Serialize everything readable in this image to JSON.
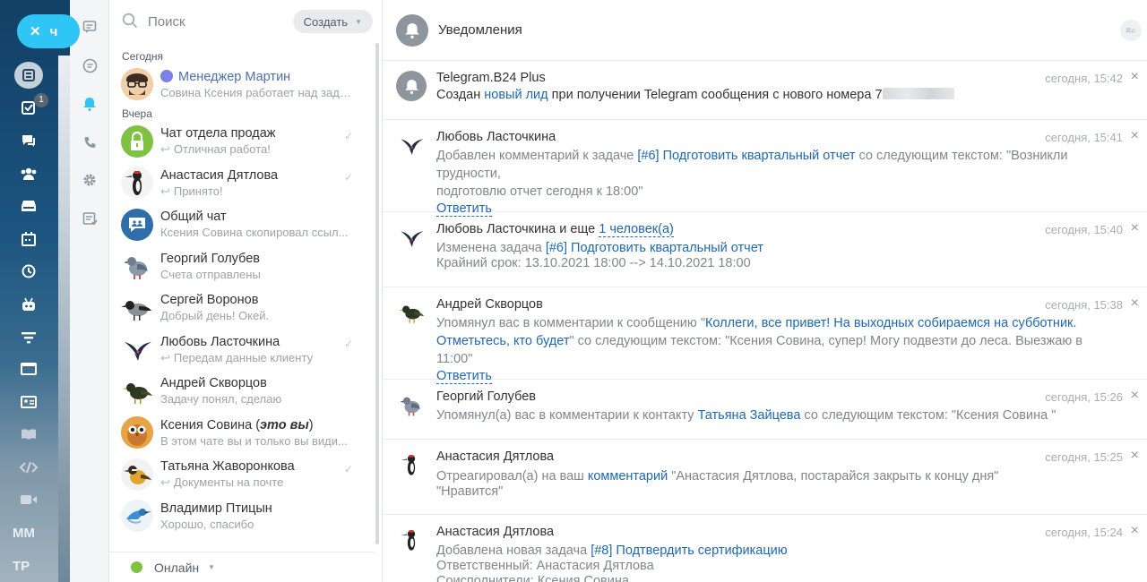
{
  "rail": {
    "close_label": "ч",
    "badge": "1",
    "bottom_labels": [
      "ММ",
      "ТР"
    ]
  },
  "recent": {
    "search_placeholder": "Поиск",
    "create_label": "Создать",
    "section_today": "Сегодня",
    "section_yesterday": "Вчера",
    "items": [
      {
        "name": "Менеджер Мартин",
        "message": "Совина Ксения работает над зада..."
      },
      {
        "name": "Чат отдела продаж",
        "message": "Отличная работа!"
      },
      {
        "name": "Анастасия Дятлова",
        "message": "Принято!"
      },
      {
        "name": "Общий чат",
        "message": "Ксения Совина скопировал ссыл..."
      },
      {
        "name": "Георгий Голубев",
        "message": "Счета отправлены"
      },
      {
        "name": "Сергей Воронов",
        "message": "Добрый день! Окей."
      },
      {
        "name": "Любовь Ласточкина",
        "message": "Передам данные клиенту"
      },
      {
        "name": "Андрей Скворцов",
        "message": "Задачу понял, сделаю"
      },
      {
        "name": "Ксения Совина",
        "name_suffix": "это вы",
        "message": "В этом чате вы и только вы види..."
      },
      {
        "name": "Татьяна Жаворонкова",
        "message": "Документы на почте"
      },
      {
        "name": "Владимир Птицын",
        "message": "Хорошо, спасибо"
      }
    ],
    "status": "Онлайн",
    "colors": {
      "status_online": "#7fc242",
      "accent": "#2fc6f6",
      "link": "#2067b0"
    }
  },
  "notifications": {
    "title": "Уведомления",
    "reply_label": "Ответить",
    "items": [
      {
        "sender": "Telegram.B24 Plus",
        "time": "сегодня, 15:42",
        "line1_pre": "Создан ",
        "line1_link": "новый лид",
        "line1_post": " при получении Telegram сообщения с нового номера 7"
      },
      {
        "sender": "Любовь Ласточкина",
        "time": "сегодня, 15:41",
        "line1_pre": "Добавлен комментарий к задаче ",
        "line1_link": "[#6] Подготовить квартальный отчет",
        "line1_post": " со следующим текстом: \"Возникли трудности,",
        "line2": "подготовлю отчет сегодня к 18:00\""
      },
      {
        "sender": "Любовь Ласточкина и еще ",
        "sender_link": "1 человек(а)",
        "time": "сегодня, 15:40",
        "line1_pre": "Изменена задача ",
        "line1_link": "[#6] Подготовить квартальный отчет",
        "line2": "Крайний срок: 13.10.2021 18:00 --> 14.10.2021 18:00"
      },
      {
        "sender": "Андрей Скворцов",
        "time": "сегодня, 15:38",
        "line1_pre": "Упомянул вас в комментарии к сообщению \"",
        "line1_link": "Коллеги, все привет! На выходных собираемся на субботник.",
        "line2_link": "Отметьтесь, кто будет",
        "line2_post": "\" со следующим текстом: \"Ксения Совина, супер! Могу подвезти до леса. Выезжаю в 11:00\""
      },
      {
        "sender": "Георгий Голубев",
        "time": "сегодня, 15:26",
        "line1_pre": "Упомянул(а) вас в комментарии к контакту ",
        "line1_link": "Татьяна Зайцева",
        "line1_post": " со следующим текстом: \"Ксения Совина \""
      },
      {
        "sender": "Анастасия Дятлова",
        "time": "сегодня, 15:25",
        "line1_pre": "Отреагировал(а) на ваш ",
        "line1_link": "комментарий",
        "line1_post": " \"Анастасия Дятлова, постарайся закрыть к концу дня\"",
        "line2": "\"Нравится\""
      },
      {
        "sender": "Анастасия Дятлова",
        "time": "сегодня, 15:24",
        "line1_pre": "Добавлена новая задача ",
        "line1_link": "[#8] Подтвердить сертификацию",
        "line2": "Ответственный: Анастасия Дятлова",
        "line3": "Соисполнители: Ксения Совина"
      }
    ]
  }
}
